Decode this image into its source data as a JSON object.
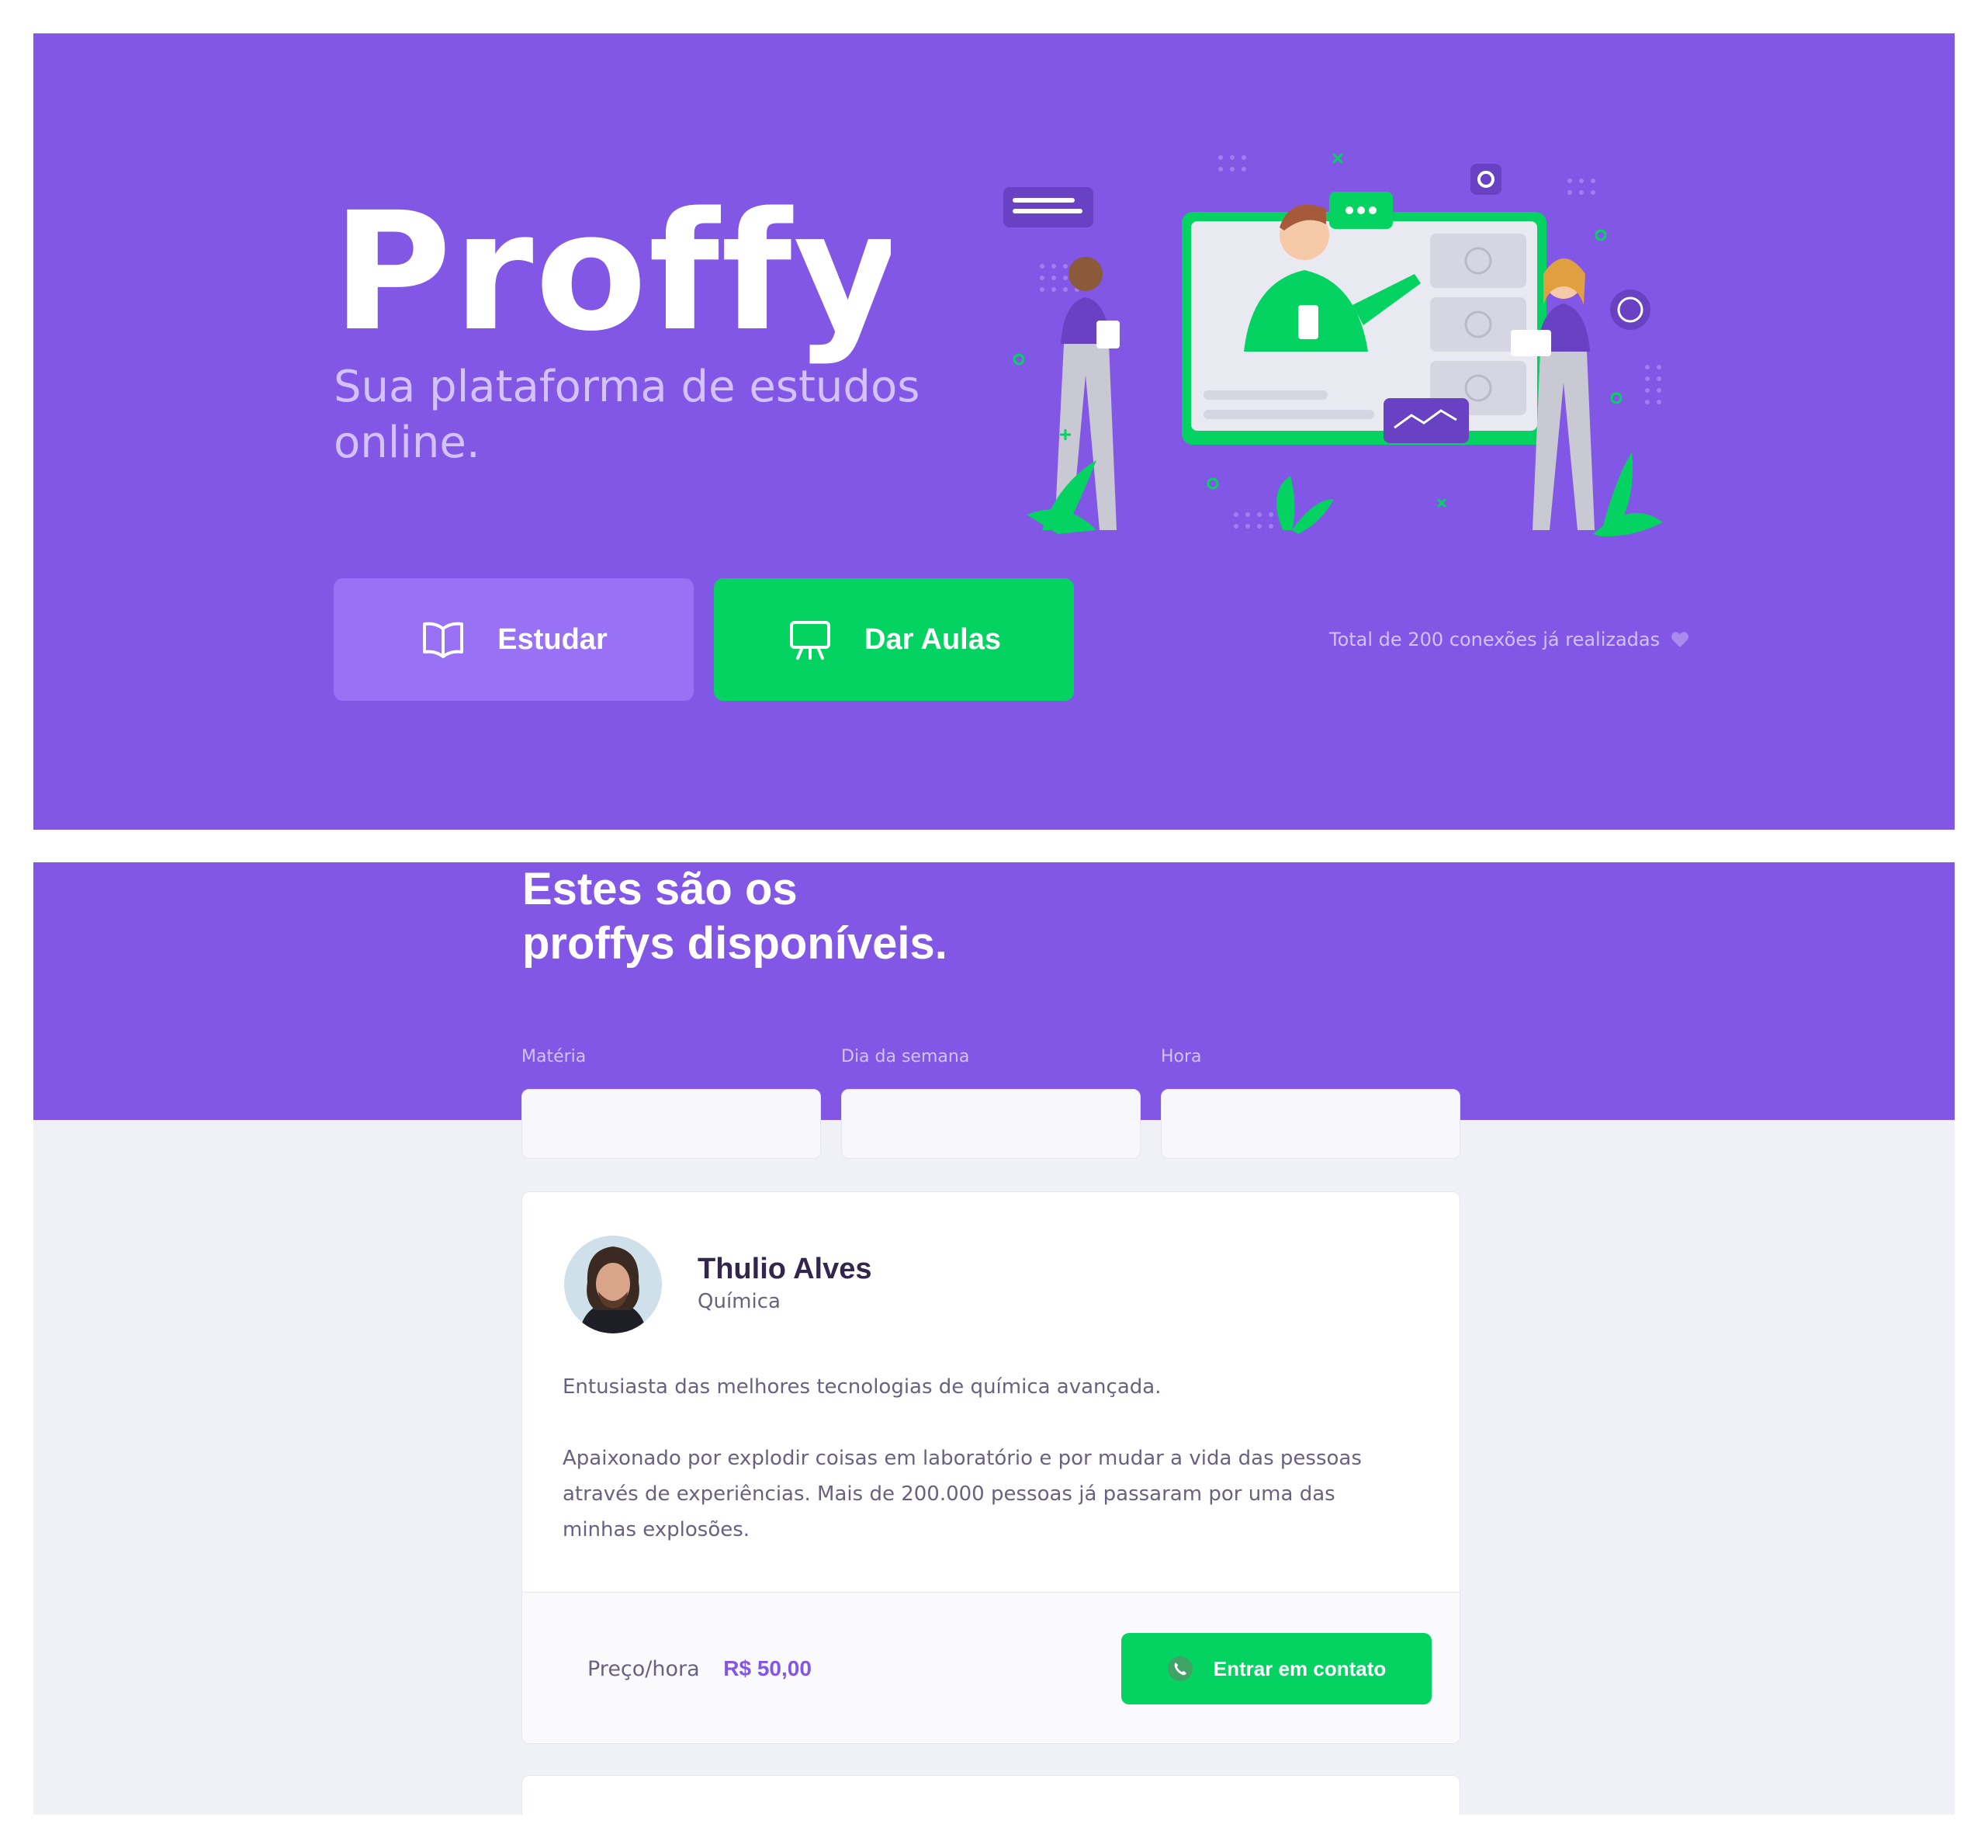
{
  "landing": {
    "logo_text": "Proffy",
    "tagline": "Sua plataforma de estudos online.",
    "buttons": {
      "study": {
        "label": "Estudar",
        "icon": "book-open-icon"
      },
      "teach": {
        "label": "Dar Aulas",
        "icon": "presentation-board-icon"
      }
    },
    "connections_text": "Total de 200 conexões já realizadas",
    "connections_icon": "heart-icon"
  },
  "list_page": {
    "title_line1": "Estes são os",
    "title_line2": "proffys disponíveis.",
    "filters": [
      {
        "label": "Matéria",
        "value": ""
      },
      {
        "label": "Dia da semana",
        "value": ""
      },
      {
        "label": "Hora",
        "value": ""
      }
    ],
    "teachers": [
      {
        "name": "Thulio Alves",
        "subject": "Química",
        "bio_1": "Entusiasta das melhores tecnologias de química avançada.",
        "bio_2": "Apaixonado por explodir coisas em laboratório e por mudar a vida das pessoas através de experiências. Mais de 200.000 pessoas já passaram por uma das minhas explosões.",
        "price_label": "Preço/hora",
        "price_value": "R$ 50,00",
        "contact_label": "Entrar em contato",
        "contact_icon": "whatsapp-icon"
      }
    ]
  },
  "colors": {
    "primary": "#8257e5",
    "primary_light": "#9871f5",
    "secondary": "#04d361",
    "text_title": "#32264d",
    "text_body": "#6a6180",
    "background": "#f0f0f7"
  }
}
